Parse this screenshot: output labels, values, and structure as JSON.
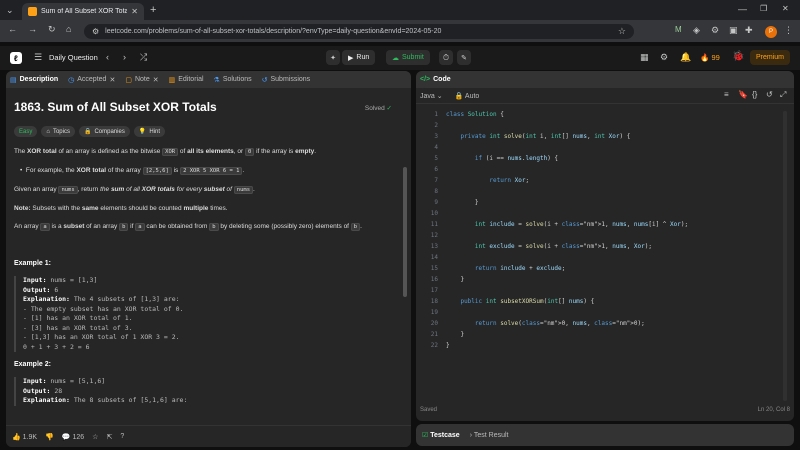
{
  "browser": {
    "tab_title": "Sum of All Subset XOR Totals",
    "url": "leetcode.com/problems/sum-of-all-subset-xor-totals/description/?envType=daily-question&envId=2024-05-20"
  },
  "nav": {
    "daily": "Daily Question",
    "run": "Run",
    "submit": "Submit",
    "streak": "99",
    "premium": "Premium"
  },
  "tabs": {
    "description": "Description",
    "accepted": "Accepted",
    "note": "Note",
    "editorial": "Editorial",
    "solutions": "Solutions",
    "submissions": "Submissions"
  },
  "problem": {
    "title": "1863. Sum of All Subset XOR Totals",
    "status": "Solved",
    "difficulty": "Easy",
    "topics": "Topics",
    "companies": "Companies",
    "hint": "Hint",
    "p1_a": "The ",
    "p1_b": "XOR total",
    "p1_c": " of an array is defined as the bitwise ",
    "p1_d": "XOR",
    "p1_e": " of ",
    "p1_f": "all its elements",
    "p1_g": ", or ",
    "p1_h": "0",
    "p1_i": " if the array is ",
    "p1_j": "empty",
    "p1_k": ".",
    "b1_a": "For example, the ",
    "b1_b": "XOR total",
    "b1_c": " of the array ",
    "b1_d": "[2,5,6]",
    "b1_e": " is ",
    "b1_f": "2 XOR 5 XOR 6 = 1",
    "b1_g": ".",
    "p2_a": "Given an array ",
    "p2_b": "nums",
    "p2_c": ", return ",
    "p2_d": "the ",
    "p2_e": "sum",
    "p2_f": " of all ",
    "p2_g": "XOR totals",
    "p2_h": " for every ",
    "p2_i": "subset",
    "p2_j": " of ",
    "p2_k": "nums",
    "p2_l": ".",
    "note_a": "Note:",
    "note_b": " Subsets with the ",
    "note_c": "same",
    "note_d": " elements should be counted ",
    "note_e": "multiple",
    "note_f": " times.",
    "p3_a": "An array ",
    "p3_b": "a",
    "p3_c": " is a ",
    "p3_d": "subset",
    "p3_e": " of an array ",
    "p3_f": "b",
    "p3_g": " if ",
    "p3_h": "a",
    "p3_i": " can be obtained from ",
    "p3_j": "b",
    "p3_k": " by deleting some (possibly zero) elements of ",
    "p3_l": "b",
    "p3_m": ".",
    "ex1_title": "Example 1:",
    "ex1_input_label": "Input:",
    "ex1_input": " nums = [1,3]",
    "ex1_output_label": "Output:",
    "ex1_output": " 6",
    "ex1_expl_label": "Explanation:",
    "ex1_expl": " The 4 subsets of [1,3] are:",
    "ex1_l1": "- The empty subset has an XOR total of 0.",
    "ex1_l2": "- [1] has an XOR total of 1.",
    "ex1_l3": "- [3] has an XOR total of 3.",
    "ex1_l4": "- [1,3] has an XOR total of 1 XOR 3 = 2.",
    "ex1_l5": "0 + 1 + 3 + 2 = 6",
    "ex2_title": "Example 2:",
    "ex2_input_label": "Input:",
    "ex2_input": " nums = [5,1,6]",
    "ex2_output_label": "Output:",
    "ex2_output": " 28",
    "ex2_expl_label": "Explanation:",
    "ex2_expl": " The 8 subsets of [5,1,6] are:",
    "likes": "1.9K",
    "comments": "126"
  },
  "editor": {
    "tab": "Code",
    "language": "Java",
    "mode": "Auto",
    "saved": "Saved",
    "cursor": "Ln 20, Col 8",
    "testcase": "Testcase",
    "test_result": "Test Result",
    "lines": [
      "class Solution {",
      "",
      "    private int solve(int i, int[] nums, int Xor) {",
      "",
      "        if (i == nums.length) {",
      "",
      "            return Xor;",
      "",
      "        }",
      "",
      "        int include = solve(i + 1, nums, nums[i] ^ Xor);",
      "",
      "        int exclude = solve(i + 1, nums, Xor);",
      "",
      "        return include + exclude;",
      "    }",
      "",
      "    public int subsetXORSum(int[] nums) {",
      "",
      "        return solve(0, nums, 0);",
      "    }",
      "}"
    ]
  },
  "colors": {
    "accent": "#ffa116",
    "run_green": "#2cbb5d",
    "solved": "#2cbb5d"
  }
}
